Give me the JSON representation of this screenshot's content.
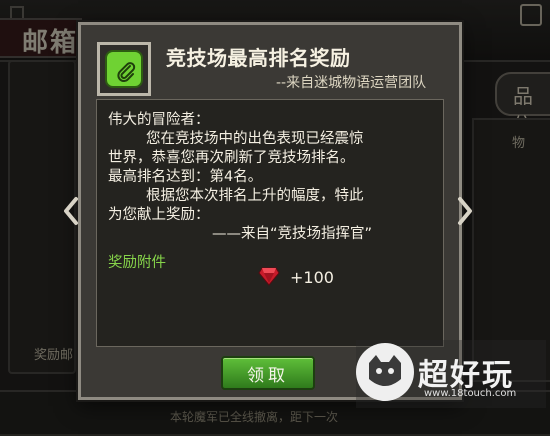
{
  "background": {
    "title_fragment": "邮箱",
    "left_label": "奖励邮",
    "right_tab_icon": "品",
    "right_tab_label": "信",
    "right_panel_label": "物",
    "bottom_text": "本轮魔军已全线撤离，距下一次"
  },
  "mail": {
    "icon": "paperclip-icon",
    "title": "竞技场最高排名奖励",
    "sender": "--来自迷城物语运营团队",
    "body_lines": [
      "伟大的冒险者：",
      "您在竞技场中的出色表现已经震惊",
      "世界，恭喜您再次刷新了竞技场排名。",
      "最高排名达到：第4名。",
      "根据您本次排名上升的幅度，特此",
      "为您献上奖励：",
      "——来自“竞技场指挥官”"
    ],
    "attachment_label": "奖励附件",
    "reward": {
      "icon": "ruby-gem-icon",
      "amount": "+100"
    },
    "claim_label": "领取"
  },
  "watermark": {
    "brand": "超好玩",
    "url": "www.18touch.com"
  },
  "colors": {
    "accent_green": "#6fd233",
    "attachment_green": "#86d44a",
    "panel": "#3b3935",
    "body": "#24231f"
  }
}
